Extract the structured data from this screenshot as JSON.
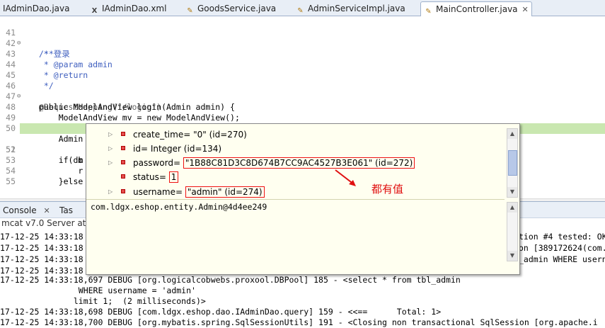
{
  "tabs": [
    {
      "label": "IAdminDao.java",
      "icon": "java-file-icon",
      "active": false
    },
    {
      "label": "IAdminDao.xml",
      "icon": "xml-file-icon",
      "active": false
    },
    {
      "label": "GoodsService.java",
      "icon": "java-file-icon",
      "active": false
    },
    {
      "label": "AdminServiceImpl.java",
      "icon": "java-file-icon",
      "active": false
    },
    {
      "label": "MainController.java",
      "icon": "java-file-icon",
      "active": true
    }
  ],
  "code_lines": [
    {
      "num": "41",
      "text": "/**"
    },
    {
      "num": "42",
      "text": " * 登录"
    },
    {
      "num": "43",
      "text": " * @param admin"
    },
    {
      "num": "44",
      "text": " * @return"
    },
    {
      "num": "45",
      "text": " */"
    },
    {
      "num": "46",
      "text": "@RequestMapping(\"/login\")"
    },
    {
      "num": "47",
      "text": "public ModelAndView login(Admin admin) {"
    },
    {
      "num": "48",
      "text": "    ModelAndView mv = new ModelAndView();"
    },
    {
      "num": "49",
      "text": ""
    },
    {
      "num": "50",
      "text": "    Admin dbadmin = adminService.login(admin);"
    },
    {
      "num": "51",
      "text": "    if(db"
    },
    {
      "num": "52",
      "text": "        m"
    },
    {
      "num": "53",
      "text": "        r"
    },
    {
      "num": "54",
      "text": "    }else"
    },
    {
      "num": "55",
      "text": ""
    }
  ],
  "debug_popup": {
    "fields": [
      {
        "name": "create_time",
        "value": "\"0\" (id=270)",
        "boxed": false
      },
      {
        "name": "id",
        "value": "Integer  (id=134)",
        "boxed": false
      },
      {
        "name": "password",
        "value": "\"1B88C81D3C8D674B7CC9AC4527B3E061\" (id=272)",
        "boxed": true
      },
      {
        "name": "status",
        "value": "1",
        "boxed": true
      },
      {
        "name": "username",
        "value": "\"admin\" (id=274)",
        "boxed": true
      }
    ],
    "detail": "com.ldgx.eshop.entity.Admin@4d4ee249"
  },
  "annotation": "都有值",
  "console": {
    "tabs": [
      "Console",
      "Tas"
    ],
    "header": "mcat v7.0 Server at lo",
    "lines": [
      {
        "left": "17-12-25 14:33:18",
        "right": "tion #4 tested: OK"
      },
      {
        "left": "17-12-25 14:33:18",
        "right": "on [389172624(com."
      },
      {
        "left": "17-12-25 14:33:18",
        "right": "_admin WHERE userna"
      },
      {
        "left": "17-12-25 14:33:18",
        "right": ""
      },
      {
        "left": "17-12-25 14:33:18,697 DEBUG [org.logicalcobwebs.proxool.DBPool] 185 - <select * from tbl_admin",
        "right": ""
      },
      {
        "left": "                WHERE username = 'admin'",
        "right": ""
      },
      {
        "left": "               limit 1;  (2 milliseconds)>",
        "right": ""
      },
      {
        "left": "17-12-25 14:33:18,698 DEBUG [com.ldgx.eshop.dao.IAdminDao.query] 159 - <<==      Total: 1>",
        "right": ""
      },
      {
        "left": "17-12-25 14:33:18,700 DEBUG [org.mybatis.spring.SqlSessionUtils] 191 - <Closing non transactional SqlSession [org.apache.i",
        "right": ""
      }
    ]
  }
}
